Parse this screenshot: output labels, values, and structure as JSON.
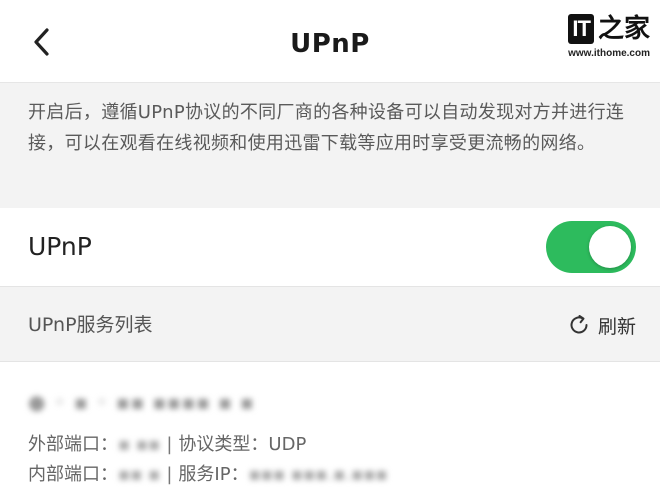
{
  "header": {
    "title": "UPnP",
    "back_icon": "chevron-left-icon"
  },
  "watermark": {
    "brand_it": "IT",
    "brand_home": "之家",
    "url": "www.ithome.com"
  },
  "description": "开启后，遵循UPnP协议的不同厂商的各种设备可以自动发现对方并进行连接，可以在观看在线视频和使用迅雷下载等应用时享受更流畅的网络。",
  "toggle": {
    "label": "UPnP",
    "state": "on",
    "color": "#2dbb5d"
  },
  "service_list": {
    "title": "UPnP服务列表",
    "refresh_label": "刷新",
    "refresh_icon": "refresh-icon",
    "items": [
      {
        "name": "● ◦ ▪ ◦ ▪▪ ▪▪▪▪ ▪ ▪",
        "external_port_label": "外部端口：",
        "external_port_value": "▪ ▪▪",
        "protocol_label": "协议类型：",
        "protocol_value": "UDP",
        "internal_port_label": "内部端口：",
        "internal_port_value": "▪▪ ▪",
        "service_ip_label": "服务IP：",
        "service_ip_value": "▪▪▪ ▪▪▪.▪.▪▪▪",
        "separator": "|"
      }
    ]
  }
}
